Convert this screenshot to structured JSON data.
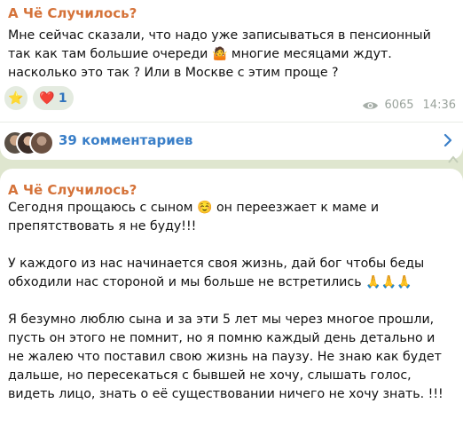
{
  "post1": {
    "author": "А Чё Случилось?",
    "lines": [
      "Мне сейчас сказали, что надо уже записываться в пенсионный",
      "так как там большие очереди",
      " многие месяцами ждут.",
      "насколько это так ? Или в Москве с этим проще ?"
    ],
    "emoji_man": "🤷",
    "reactions": [
      {
        "icon": "star-icon",
        "glyph": "⭐",
        "count": ""
      },
      {
        "icon": "heart-icon",
        "glyph": "❤️",
        "count": "1"
      }
    ],
    "views": "6065",
    "time": "14:36",
    "comments_label": "39 комментариев"
  },
  "post2": {
    "author": "А Чё Случилось?",
    "p1_a": "Сегодня  прощаюсь с сыном ",
    "p1_emoji": "☺️",
    "p1_b": " он переезжает к маме и",
    "p1_line2": "препятствовать я не буду!!!",
    "p2_line1": "У каждого из нас начинается своя жизнь, дай бог чтобы беды",
    "p2_line2": "обходили нас стороной и мы больше не встретились ",
    "p2_emoji": "🙏🙏🙏",
    "p3_lines": [
      "Я безумно люблю сына и за эти 5 лет мы через многое прошли,",
      "пусть он этого не помнит, но я помню каждый день детально и",
      "не жалею что поставил свою жизнь на паузу. Не знаю как будет",
      "дальше, но пересекаться с бывшей не хочу, слышать голос,",
      "видеть лицо, знать о её существовании ничего не хочу знать. !!!"
    ]
  },
  "colors": {
    "background": "#dfe6cf",
    "author": "#d5733a",
    "link": "#3a7fc8",
    "meta": "#9aa39c"
  }
}
